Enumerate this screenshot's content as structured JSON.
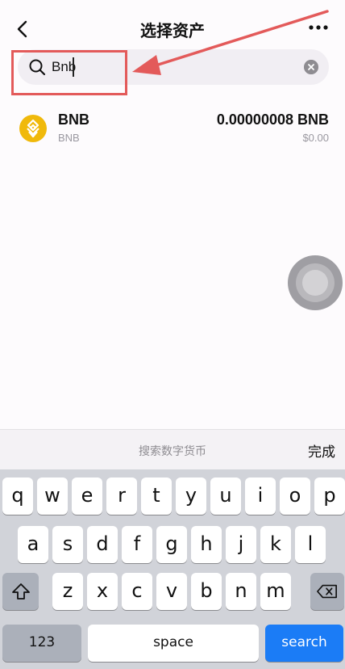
{
  "header": {
    "title": "选择资产",
    "back_icon": "chevron-left-icon",
    "more_icon": "more-horizontal-icon"
  },
  "search": {
    "value": "Bnb",
    "icon": "search-icon",
    "clear_icon": "clear-circle-icon"
  },
  "assets": [
    {
      "symbol": "BNB",
      "network": "BNB",
      "balance": "0.00000008 BNB",
      "fiat_value": "$0.00",
      "icon": "bnb-coin-icon",
      "icon_color": "#f0b90b"
    }
  ],
  "annotation": {
    "color": "#e35a5a"
  },
  "keyboard": {
    "accessory_hint": "搜索数字货币",
    "done_label": "完成",
    "row1": [
      "q",
      "w",
      "e",
      "r",
      "t",
      "y",
      "u",
      "i",
      "o",
      "p"
    ],
    "row2": [
      "a",
      "s",
      "d",
      "f",
      "g",
      "h",
      "j",
      "k",
      "l"
    ],
    "row3": [
      "z",
      "x",
      "c",
      "v",
      "b",
      "n",
      "m"
    ],
    "numbers_label": "123",
    "space_label": "space",
    "search_label": "search",
    "accent_color": "#1b7cf6"
  }
}
